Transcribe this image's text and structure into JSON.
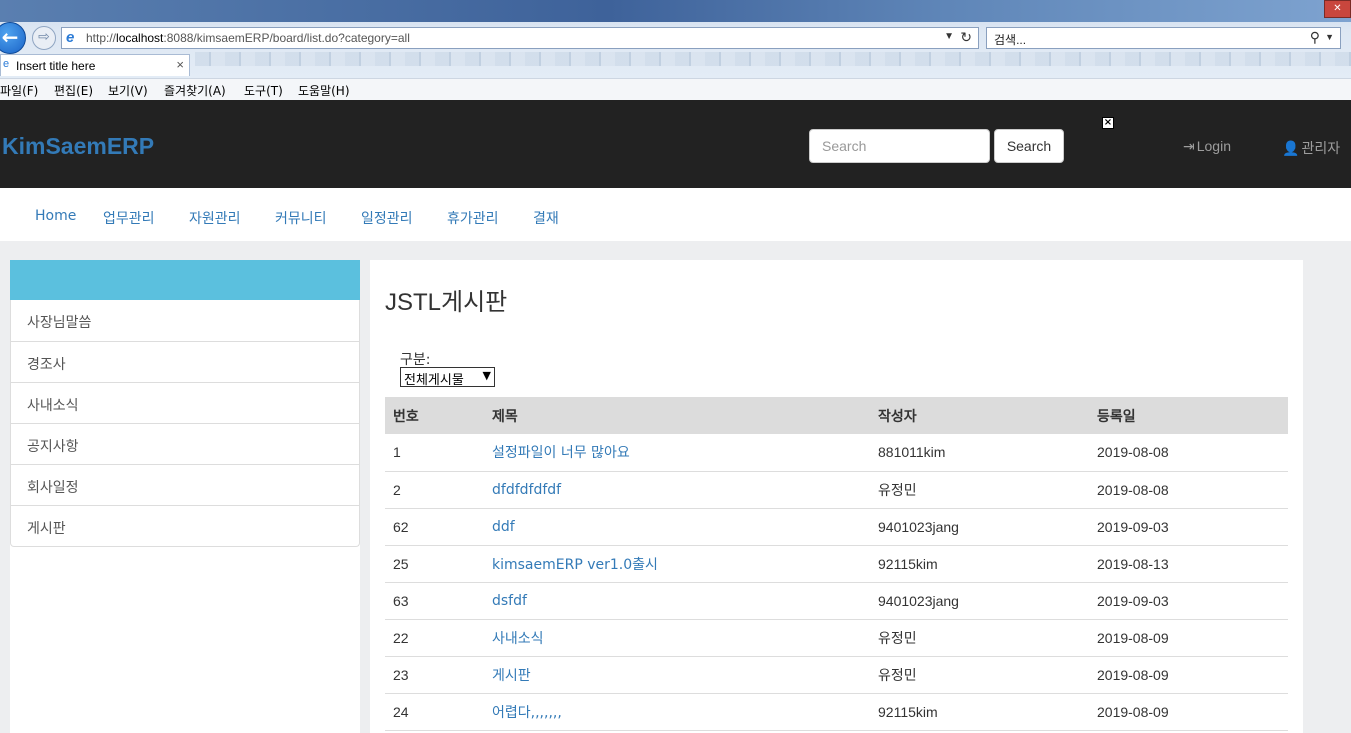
{
  "browser": {
    "url_prefix": "http://",
    "url_host": "localhost",
    "url_rest": ":8088/kimsaemERP/board/list.do?category=all",
    "search_placeholder": "검색...",
    "tab_title": "Insert title here",
    "tab_close": "×",
    "back_glyph": "←",
    "forward_glyph": "⇨",
    "menu": [
      "파일(F)",
      "편집(E)",
      "보기(V)",
      "즐겨찾기(A)",
      "도구(T)",
      "도움말(H)"
    ]
  },
  "navbar": {
    "brand": "KimSaemERP",
    "search_placeholder": "Search",
    "search_button": "Search",
    "login_label": "Login",
    "user_label": "관리자",
    "ad_close": "×"
  },
  "top_menu": [
    "Home",
    "업무관리",
    "자원관리",
    "커뮤니티",
    "일정관리",
    "휴가관리",
    "결재"
  ],
  "sidebar": {
    "items": [
      "사장님말씀",
      "경조사",
      "사내소식",
      "공지사항",
      "회사일정",
      "게시판"
    ]
  },
  "board": {
    "title": "JSTL게시판",
    "category_label": "구분:",
    "category_selected": "전체게시물",
    "columns": [
      "번호",
      "제목",
      "작성자",
      "등록일"
    ],
    "rows": [
      {
        "no": "1",
        "title": "설정파일이 너무 많아요",
        "author": "881011kim",
        "date": "2019-08-08"
      },
      {
        "no": "2",
        "title": "dfdfdfdfdf",
        "author": "유정민",
        "date": "2019-08-08"
      },
      {
        "no": "62",
        "title": "ddf",
        "author": "9401023jang",
        "date": "2019-09-03"
      },
      {
        "no": "25",
        "title": "kimsaemERP ver1.0출시",
        "author": "92115kim",
        "date": "2019-08-13"
      },
      {
        "no": "63",
        "title": "dsfdf",
        "author": "9401023jang",
        "date": "2019-09-03"
      },
      {
        "no": "22",
        "title": "사내소식",
        "author": "유정민",
        "date": "2019-08-09"
      },
      {
        "no": "23",
        "title": "게시판",
        "author": "유정민",
        "date": "2019-08-09"
      },
      {
        "no": "24",
        "title": "어렵다,,,,,,,",
        "author": "92115kim",
        "date": "2019-08-09"
      }
    ]
  },
  "colors": {
    "navbar_bg": "#222222",
    "brand": "#337ab7",
    "link": "#337ab7",
    "sidebar_header": "#5bc0de",
    "table_header_bg": "#dcdcdc"
  }
}
